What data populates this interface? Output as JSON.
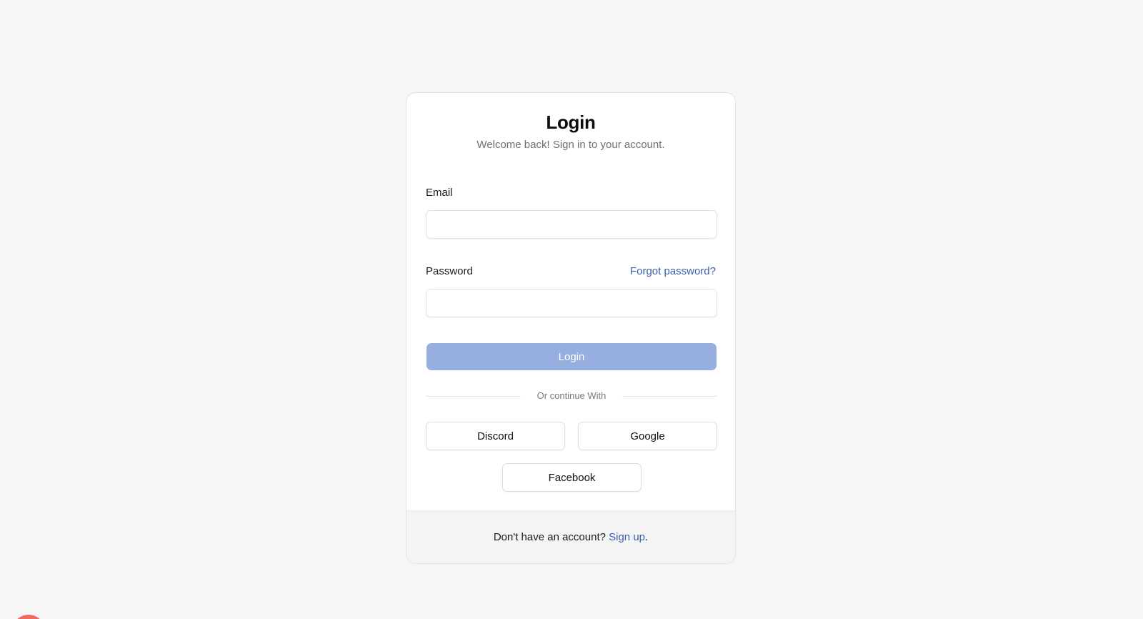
{
  "login_card": {
    "title": "Login",
    "subtitle": "Welcome back! Sign in to your account.",
    "email_label": "Email",
    "email_value": "",
    "email_placeholder": "",
    "password_label": "Password",
    "password_value": "",
    "password_placeholder": "",
    "forgot_password_link": "Forgot password?",
    "login_button": "Login",
    "divider_text": "Or continue With",
    "social_buttons": [
      {
        "label": "Discord"
      },
      {
        "label": "Google"
      },
      {
        "label": "Facebook"
      }
    ],
    "footer": {
      "prompt": "Don't have an account?",
      "signup_link": "Sign up",
      "trailing": "."
    }
  },
  "colors": {
    "page_background": "#f6f6f6",
    "card_background": "#ffffff",
    "footer_background": "#f4f4f5",
    "primary_button_disabled": "#97afe0",
    "link": "#3d5eae",
    "corner_blob": "#ef6a5f"
  }
}
